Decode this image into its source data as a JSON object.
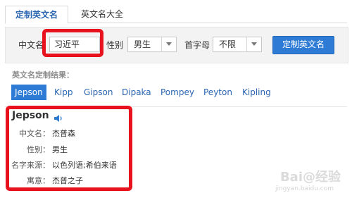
{
  "tabs": [
    {
      "label": "定制英文名",
      "active": true
    },
    {
      "label": "英文名大全",
      "active": false
    }
  ],
  "form": {
    "chinese_name_label": "中文名",
    "chinese_name_value": "习近平",
    "gender_label": "性别",
    "gender_value": "男生",
    "initial_label": "首字母",
    "initial_value": "不限",
    "submit_label": "定制英文名"
  },
  "results": {
    "title": "英文名定制结果：",
    "names": [
      "Jepson",
      "Kipp",
      "Gipson",
      "Dipaka",
      "Pompey",
      "Peyton",
      "Kipling"
    ],
    "selected": "Jepson"
  },
  "detail": {
    "name": "Jepson",
    "rows": [
      {
        "key": "中文名：",
        "value": "杰普森"
      },
      {
        "key": "性别：",
        "value": "男生"
      },
      {
        "key": "名字来源：",
        "value": "以色列语;希伯来语"
      },
      {
        "key": "寓意：",
        "value": "杰普之子"
      }
    ]
  },
  "colors": {
    "accent": "#2e7bd6",
    "highlight_box": "#e8121e"
  }
}
